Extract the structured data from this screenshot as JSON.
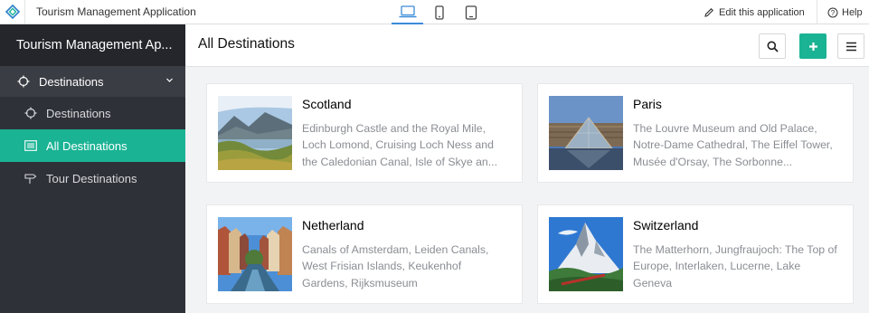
{
  "topbar": {
    "app_name": "Tourism Management Application",
    "edit_label": "Edit this application",
    "help_label": "Help",
    "devices": [
      "laptop-icon",
      "phone-icon",
      "tablet-icon"
    ]
  },
  "sidebar": {
    "title": "Tourism Management Ap...",
    "section_label": "Destinations",
    "items": [
      {
        "label": "Destinations",
        "icon": "crosshair-icon"
      },
      {
        "label": "All Destinations",
        "icon": "list-icon",
        "active": true
      },
      {
        "label": "Tour Destinations",
        "icon": "signpost-icon"
      }
    ]
  },
  "main": {
    "title": "All Destinations",
    "buttons": [
      "search-icon",
      "plus-icon",
      "hamburger-icon"
    ]
  },
  "cards": [
    {
      "title": "Scotland",
      "description": "Edinburgh Castle and the Royal Mile, Loch Lomond, Cruising Loch Ness and the Caledonian Canal, Isle of Skye an..."
    },
    {
      "title": "Paris",
      "description": "The Louvre Museum and Old Palace, Notre-Dame Cathedral, The Eiffel Tower, Musée d'Orsay, The Sorbonne..."
    },
    {
      "title": "Netherland",
      "description": "Canals of Amsterdam, Leiden Canals, West Frisian Islands, Keukenhof Gardens, Rijksmuseum"
    },
    {
      "title": "Switzerland",
      "description": "The Matterhorn, Jungfraujoch: The Top of Europe, Interlaken, Lucerne, Lake Geneva"
    }
  ],
  "colors": {
    "accent": "#1ab394",
    "sidebar_bg": "#2f3138",
    "sidebar_header_bg": "#24262b",
    "active_device": "#3d8bd9"
  }
}
